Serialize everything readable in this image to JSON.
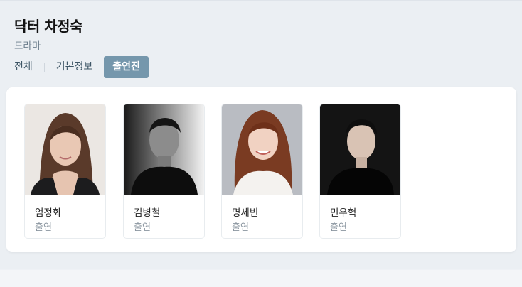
{
  "program": {
    "title": "닥터 차정숙",
    "genre": "드라마"
  },
  "tabs": [
    {
      "label": "전체",
      "active": false
    },
    {
      "label": "기본정보",
      "active": false
    },
    {
      "label": "출연진",
      "active": true
    }
  ],
  "colors": {
    "active_tab": "#7597ac",
    "tab_text": "#3e5666",
    "page_bg": "#ebeff3"
  },
  "cast": [
    {
      "name": "엄정화",
      "role": "출연"
    },
    {
      "name": "김병철",
      "role": "출연"
    },
    {
      "name": "명세빈",
      "role": "출연"
    },
    {
      "name": "민우혁",
      "role": "출연"
    }
  ]
}
